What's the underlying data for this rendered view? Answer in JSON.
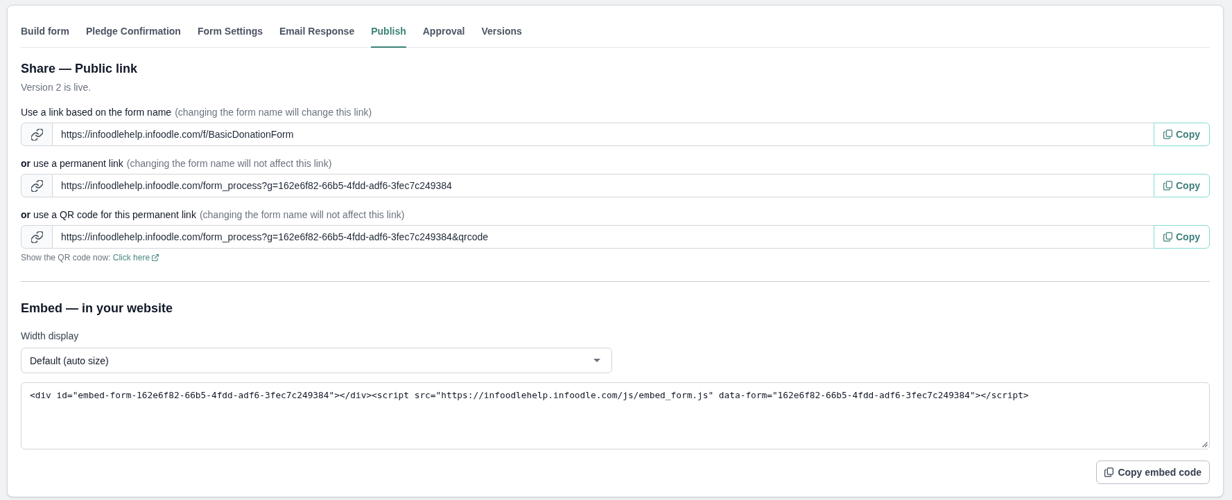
{
  "tabs": [
    {
      "label": "Build form",
      "selected": false
    },
    {
      "label": "Pledge Confirmation",
      "selected": false
    },
    {
      "label": "Form Settings",
      "selected": false
    },
    {
      "label": "Email Response",
      "selected": false
    },
    {
      "label": "Publish",
      "selected": true
    },
    {
      "label": "Approval",
      "selected": false
    },
    {
      "label": "Versions",
      "selected": false
    }
  ],
  "share": {
    "title": "Share — Public link",
    "status": "Version 2 is live.",
    "links": [
      {
        "label": "Use a link based on the form name",
        "note": "(changing the form name will change this link)",
        "url": "https://infoodlehelp.infoodle.com/f/BasicDonationForm",
        "button": "Copy"
      },
      {
        "label": "**or** use a permanent link",
        "note": "(changing the form name will not affect this link)",
        "url": "https://infoodlehelp.infoodle.com/form_process?g=162e6f82-66b5-4fdd-adf6-3fec7c249384",
        "button": "Copy"
      },
      {
        "label": "**or** use a QR code for this permanent link",
        "note": "(changing the form name will not affect this link)",
        "url": "https://infoodlehelp.infoodle.com/form_process?g=162e6f82-66b5-4fdd-adf6-3fec7c249384&qrcode",
        "button": "Copy"
      }
    ],
    "qr_hint": {
      "text": "Show the QR code now:",
      "link": "Click here"
    }
  },
  "embed": {
    "title": "Embed — in your website",
    "width_label": "Width display",
    "width_select": "Default (auto size)",
    "code": "<div id=\"embed-form-162e6f82-66b5-4fdd-adf6-3fec7c249384\"></div><script src=\"https://infoodlehelp.infoodle.com/js/embed_form.js\" data-form=\"162e6f82-66b5-4fdd-adf6-3fec7c249384\"></script>",
    "button": "Copy embed code"
  }
}
